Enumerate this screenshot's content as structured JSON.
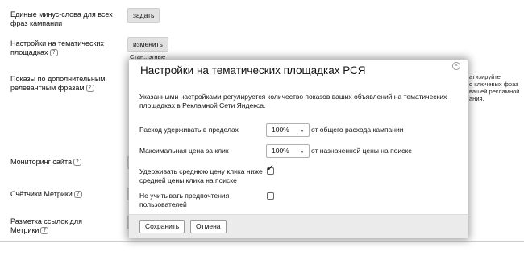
{
  "settings": {
    "negative_keywords": {
      "label_line1": "Единые минус-слова для всех",
      "label_line2": "фраз кампании",
      "button": "задать"
    },
    "thematic": {
      "label_line1": "Настройки на тематических",
      "label_line2": "площадках",
      "button": "изменить",
      "status_fragment": "Стан...этные"
    },
    "extra_phrases": {
      "label_line1": "Показы по дополнительным",
      "label_line2": "релевантным фразам"
    },
    "monitoring": {
      "label": "Мониторинг сайта"
    },
    "metrika_counters": {
      "label": "Счётчики Метрики"
    },
    "metrika_markup": {
      "label_line1": "Разметка ссылок для",
      "label_line2": "Метрики"
    }
  },
  "background_right_text": [
    "атизируйте",
    "о ключевых фраз",
    "вашей рекламной",
    "ания."
  ],
  "help_icon_glyph": "?",
  "modal": {
    "title": "Настройки на тематических площадках РСЯ",
    "close_glyph": "×",
    "description": "Указанными настройками регулируется количество показов ваших объявлений на тематических площадках в Рекламной Сети Яндекса.",
    "spend_limit": {
      "label": "Расход удерживать в пределах",
      "value": "100%",
      "suffix": "от общего расхода кампании"
    },
    "max_price": {
      "label": "Максимальная цена за клик",
      "value": "100%",
      "suffix": "от назначенной цены на поиске"
    },
    "keep_avg_price": {
      "label_line1": "Удерживать среднюю цену клика ниже",
      "label_line2": "средней цены клика на поиске",
      "checked": true
    },
    "ignore_prefs": {
      "label_line1": "Не учитывать предпочтения",
      "label_line2": "пользователей",
      "checked": false
    },
    "save_button": "Сохранить",
    "cancel_button": "Отмена"
  }
}
